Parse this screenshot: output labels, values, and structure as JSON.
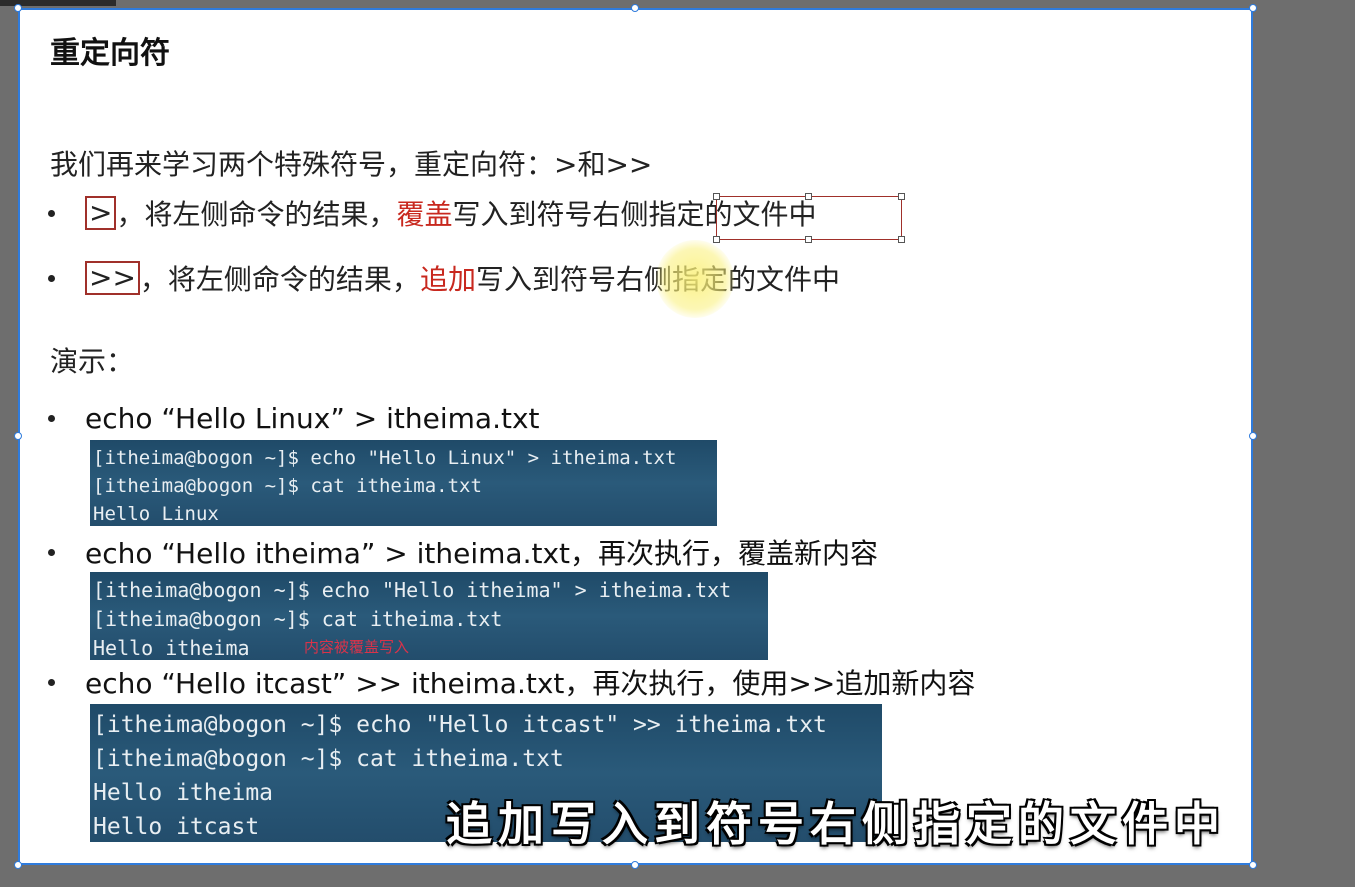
{
  "slide": {
    "title": "重定向符",
    "intro": "我们再来学习两个特殊符号，重定向符：>和>>",
    "bullets": [
      {
        "symbol": ">",
        "before": "，将左侧命令的结果，",
        "emphasis": "覆盖",
        "after": "写入到符号右侧指定的文件中"
      },
      {
        "symbol": ">>",
        "before": "，将左侧命令的结果，",
        "emphasis": "追加",
        "after": "写入到符号右侧指定的文件中"
      }
    ],
    "demo_label": "演示：",
    "demos": [
      {
        "command": "echo “Hello Linux” > itheima.txt",
        "terminal": [
          "[itheima@bogon ~]$ echo \"Hello Linux\" > itheima.txt",
          "[itheima@bogon ~]$ cat itheima.txt",
          "Hello Linux"
        ]
      },
      {
        "command": "echo “Hello itheima” > itheima.txt，再次执行，覆盖新内容",
        "terminal": [
          "[itheima@bogon ~]$ echo \"Hello itheima\" > itheima.txt",
          "[itheima@bogon ~]$ cat itheima.txt",
          "Hello itheima"
        ],
        "note": "内容被覆盖写入"
      },
      {
        "command": "echo “Hello itcast” >> itheima.txt，再次执行，使用>>追加新内容",
        "terminal": [
          "[itheima@bogon ~]$ echo \"Hello itcast\" >> itheima.txt",
          "[itheima@bogon ~]$ cat itheima.txt",
          "Hello itheima",
          "Hello itcast"
        ]
      }
    ]
  },
  "video_subtitle": "追加写入到符号右侧指定的文件中",
  "colors": {
    "emphasis": "#c8281e",
    "selection": "#2f7bdc",
    "box_border": "#a0302a"
  }
}
